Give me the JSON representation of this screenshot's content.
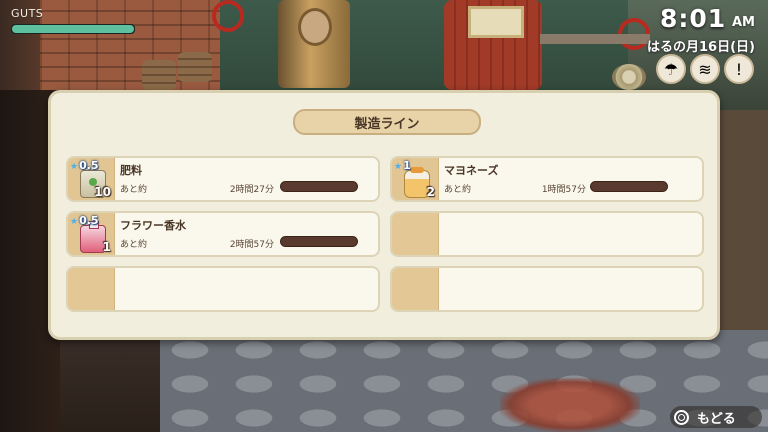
{
  "hud": {
    "guts_label": "GUTS",
    "guts_level": 1.0,
    "time": "8:01",
    "ampm": "AM",
    "date": "はるの月16日(日)",
    "weather_icons": [
      "umbrella-icon",
      "wind-icon",
      "notice-icon"
    ]
  },
  "panel": {
    "title": "製造ライン",
    "remaining_label": "あと約",
    "slots": [
      {
        "name": "肥料",
        "level": "0.5",
        "count": "10",
        "time": "2時間27分",
        "icon": "fertilizer-icon",
        "progress": 0.0
      },
      {
        "name": "マヨネーズ",
        "level": "1",
        "count": "2",
        "time": "1時間57分",
        "icon": "mayonnaise-icon",
        "progress": 0.0
      },
      {
        "name": "フラワー香水",
        "level": "0.5",
        "count": "1",
        "time": "2時間57分",
        "icon": "perfume-icon",
        "progress": 0.0
      },
      {
        "name": "",
        "empty": true
      },
      {
        "name": "",
        "empty": true
      },
      {
        "name": "",
        "empty": true
      }
    ]
  },
  "back": {
    "label": "もどる"
  },
  "colors": {
    "accent": "#e8d3a8",
    "panel": "#f1eedd",
    "guts": "#5fc0a0",
    "bar": "#5a3a2e"
  }
}
